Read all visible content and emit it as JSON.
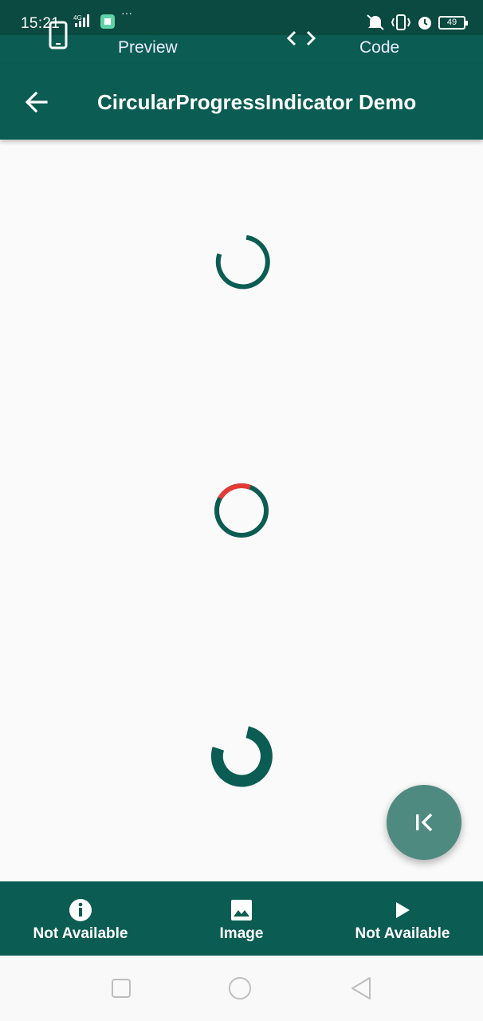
{
  "status_bar": {
    "time": "15:21",
    "network": "4G",
    "battery": "49",
    "more": "···"
  },
  "preview_bar": {
    "preview_label": "Preview",
    "code_label": "Code"
  },
  "app_bar": {
    "title": "CircularProgressIndicator Demo"
  },
  "bottom_nav": {
    "items": [
      {
        "label": "Not Available",
        "icon": "info-icon"
      },
      {
        "label": "Image",
        "icon": "image-icon"
      },
      {
        "label": "Not Available",
        "icon": "play-icon"
      }
    ]
  },
  "colors": {
    "primary": "#0b5c52",
    "status": "#0a4a40",
    "accent_red": "#e53935",
    "fab": "#4f8a80"
  }
}
